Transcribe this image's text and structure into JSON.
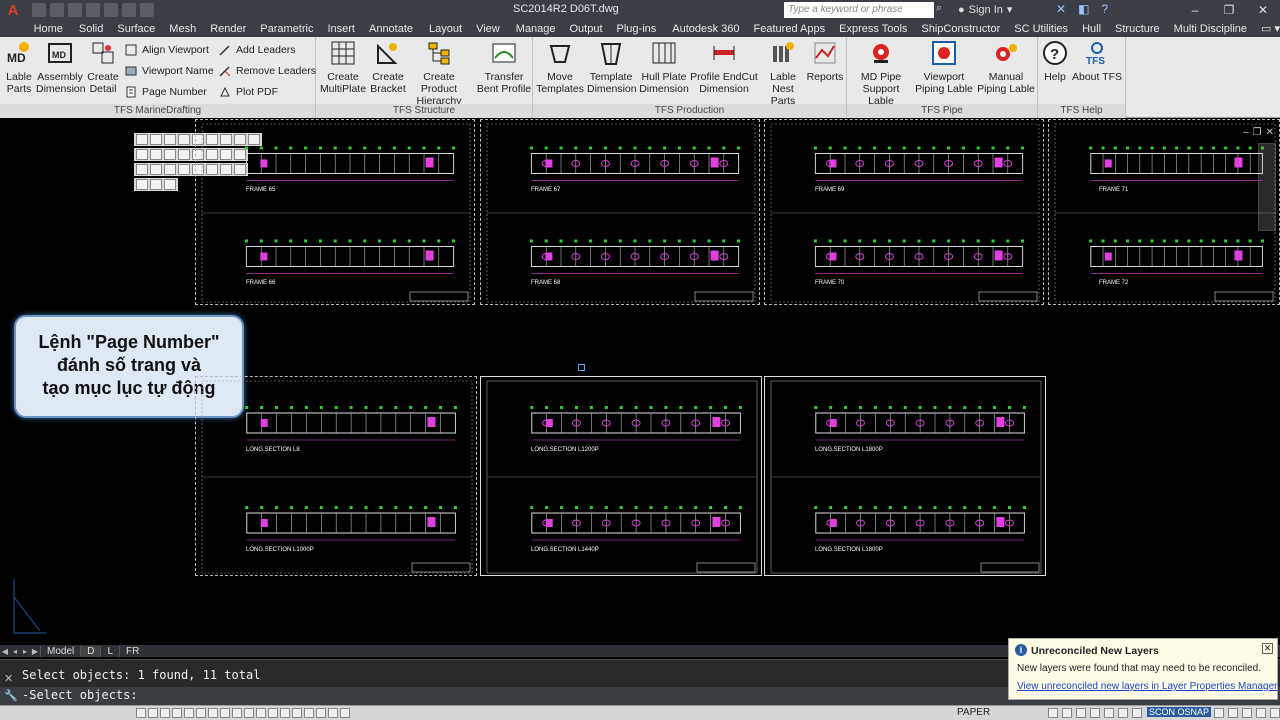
{
  "titlebar": {
    "window_title": "SC2014R2    D06T.dwg",
    "search_placeholder": "Type a keyword or phrase",
    "signin_label": "Sign In"
  },
  "ribbon_tabs": [
    "Home",
    "Solid",
    "Surface",
    "Mesh",
    "Render",
    "Parametric",
    "Insert",
    "Annotate",
    "Layout",
    "View",
    "Manage",
    "Output",
    "Plug-ins",
    "Autodesk 360",
    "Featured Apps",
    "Express Tools",
    "ShipConstructor",
    "SC Utilities",
    "Hull",
    "Structure",
    "Multi Discipline"
  ],
  "ribbon": {
    "marine": {
      "label": "TFS MarineDrafting",
      "lable_parts": "Lable\nParts",
      "assembly_dimension": "Assembly\nDimension",
      "create_detail": "Create\nDetail",
      "align_viewport": "Align Viewport",
      "viewport_name": "Viewport Name",
      "page_number": "Page Number",
      "add_leaders": "Add Leaders",
      "remove_leaders": "Remove Leaders",
      "plot_pdf": "Plot PDF"
    },
    "structure": {
      "label": "TFS Structure",
      "create_multiplate": "Create\nMultiPlate",
      "create_bracket": "Create\nBracket",
      "create_product_hierarchy": "Create Product\nHierarchy",
      "transfer_bent_profile": "Transfer\nBent Profile"
    },
    "production": {
      "label": "TFS Production",
      "move_templates": "Move\nTemplates",
      "template_dimension": "Template\nDimension",
      "hull_plate_dimension": "Hull Plate\nDimension",
      "profile_endcut_dimension": "Profile EndCut\nDimension",
      "lable_nest_parts": "Lable\nNest Parts",
      "reports": "Reports"
    },
    "pipe": {
      "label": "TFS Pipe",
      "md_pipe_support_lable": "MD Pipe\nSupport Lable",
      "viewport_piping_lable": "Viewport\nPiping Lable",
      "manual_piping_lable": "Manual\nPiping Lable"
    },
    "help": {
      "label": "TFS Help",
      "help": "Help",
      "about_tfs": "About TFS"
    }
  },
  "drawing": {
    "callout_text": "Lệnh \"Page Number\"\nđánh số trang và\ntạo mục lục tự động",
    "frames_top": [
      {
        "top": "FRAME 65",
        "bottom": "FRAME 66"
      },
      {
        "top": "FRAME 67",
        "bottom": "FRAME 68"
      },
      {
        "top": "FRAME 69",
        "bottom": "FRAME 70"
      },
      {
        "top": "FRAME 71",
        "bottom": "FRAME 72"
      }
    ],
    "frames_bottom": [
      {
        "top": "LONG.SECTION L8",
        "bottom": "LONG.SECTION L1000P"
      },
      {
        "top": "LONG.SECTION L1200P",
        "bottom": "LONG.SECTION L1440P"
      },
      {
        "top": "LONG.SECTION L1800P",
        "bottom": "LONG.SECTION L1800P"
      }
    ]
  },
  "layout_tabs": [
    "Model",
    "D",
    "L",
    "FR"
  ],
  "command": {
    "history": "Select objects: 1 found, 11 total",
    "prompt": "-Select objects:"
  },
  "statusbar": {
    "paper": "PAPER",
    "osnap": "SCON OSNAP"
  },
  "notification": {
    "title": "Unreconciled New Layers",
    "body": "New layers were found that may need to be reconciled.",
    "link": "View unreconciled new layers in Layer Properties Manager"
  },
  "colors": {
    "chrome": "#3b3f45",
    "ribbon": "#e9e9e9",
    "magenta": "#e040e0",
    "green": "#30d030",
    "callout_border": "#6c94c3"
  }
}
